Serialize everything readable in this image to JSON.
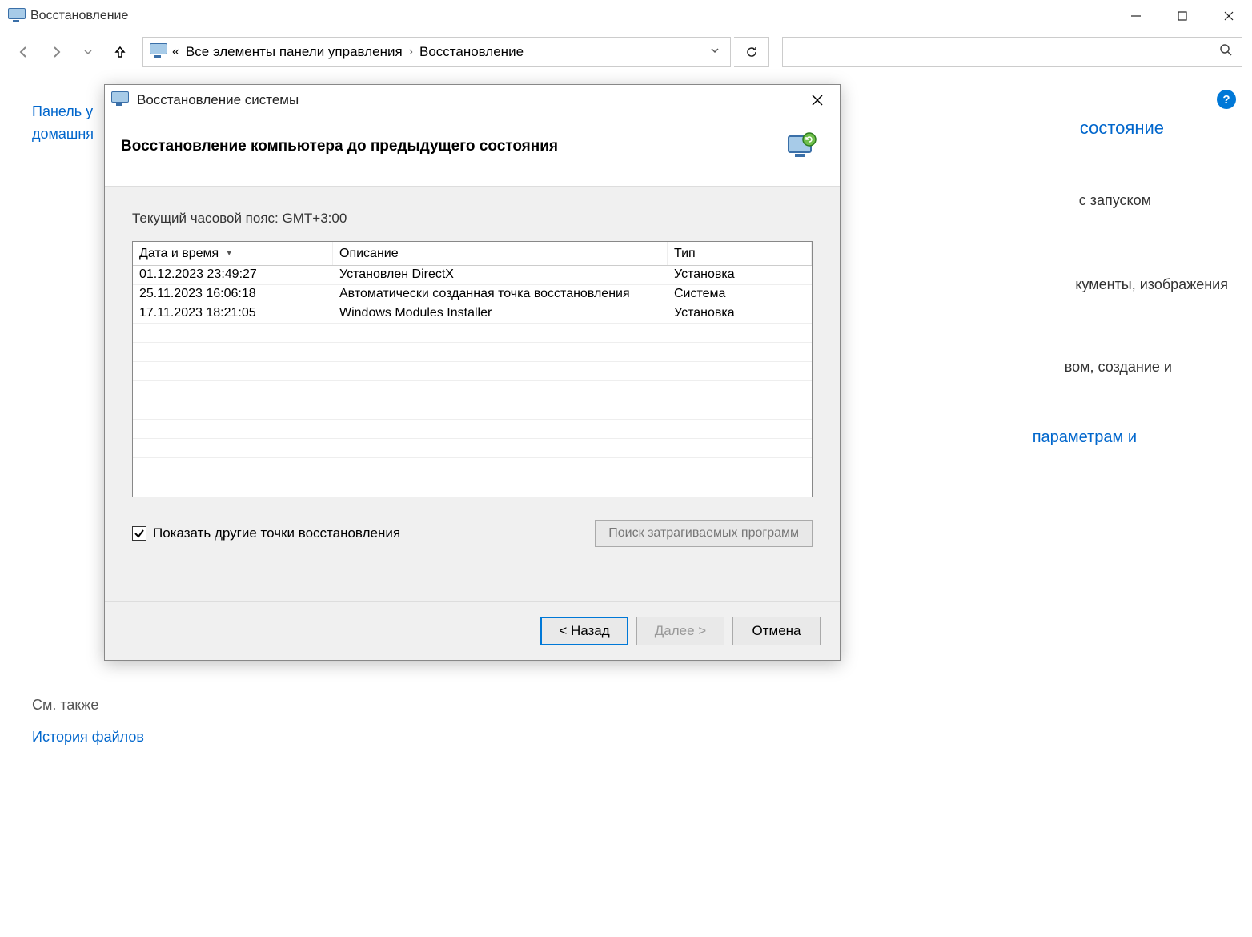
{
  "window": {
    "title": "Восстановление"
  },
  "breadcrumb": {
    "chevron": "«",
    "part1": "Все элементы панели управления",
    "sep": "›",
    "part2": "Восстановление"
  },
  "sidebar": {
    "line1": "Панель у",
    "line2": "домашня"
  },
  "right": {
    "l1": "состояние",
    "l2": "с запуском",
    "l3": "кументы, изображения",
    "l4": "вом, создание и",
    "l5": "параметрам и"
  },
  "see_also": {
    "label": "См. также",
    "link": "История файлов"
  },
  "help": "?",
  "dialog": {
    "title": "Восстановление системы",
    "header": "Восстановление компьютера до предыдущего состояния",
    "tz": "Текущий часовой пояс: GMT+3:00",
    "columns": {
      "date": "Дата и время",
      "desc": "Описание",
      "type": "Тип"
    },
    "rows": [
      {
        "date": "01.12.2023 23:49:27",
        "desc": "Установлен DirectX",
        "type": "Установка"
      },
      {
        "date": "25.11.2023 16:06:18",
        "desc": "Автоматически созданная точка восстановления",
        "type": "Система"
      },
      {
        "date": "17.11.2023 18:21:05",
        "desc": "Windows Modules Installer",
        "type": "Установка"
      }
    ],
    "checkbox": "Показать другие точки восстановления",
    "scan_btn": "Поиск затрагиваемых программ",
    "back": "< Назад",
    "next": "Далее >",
    "cancel": "Отмена"
  }
}
